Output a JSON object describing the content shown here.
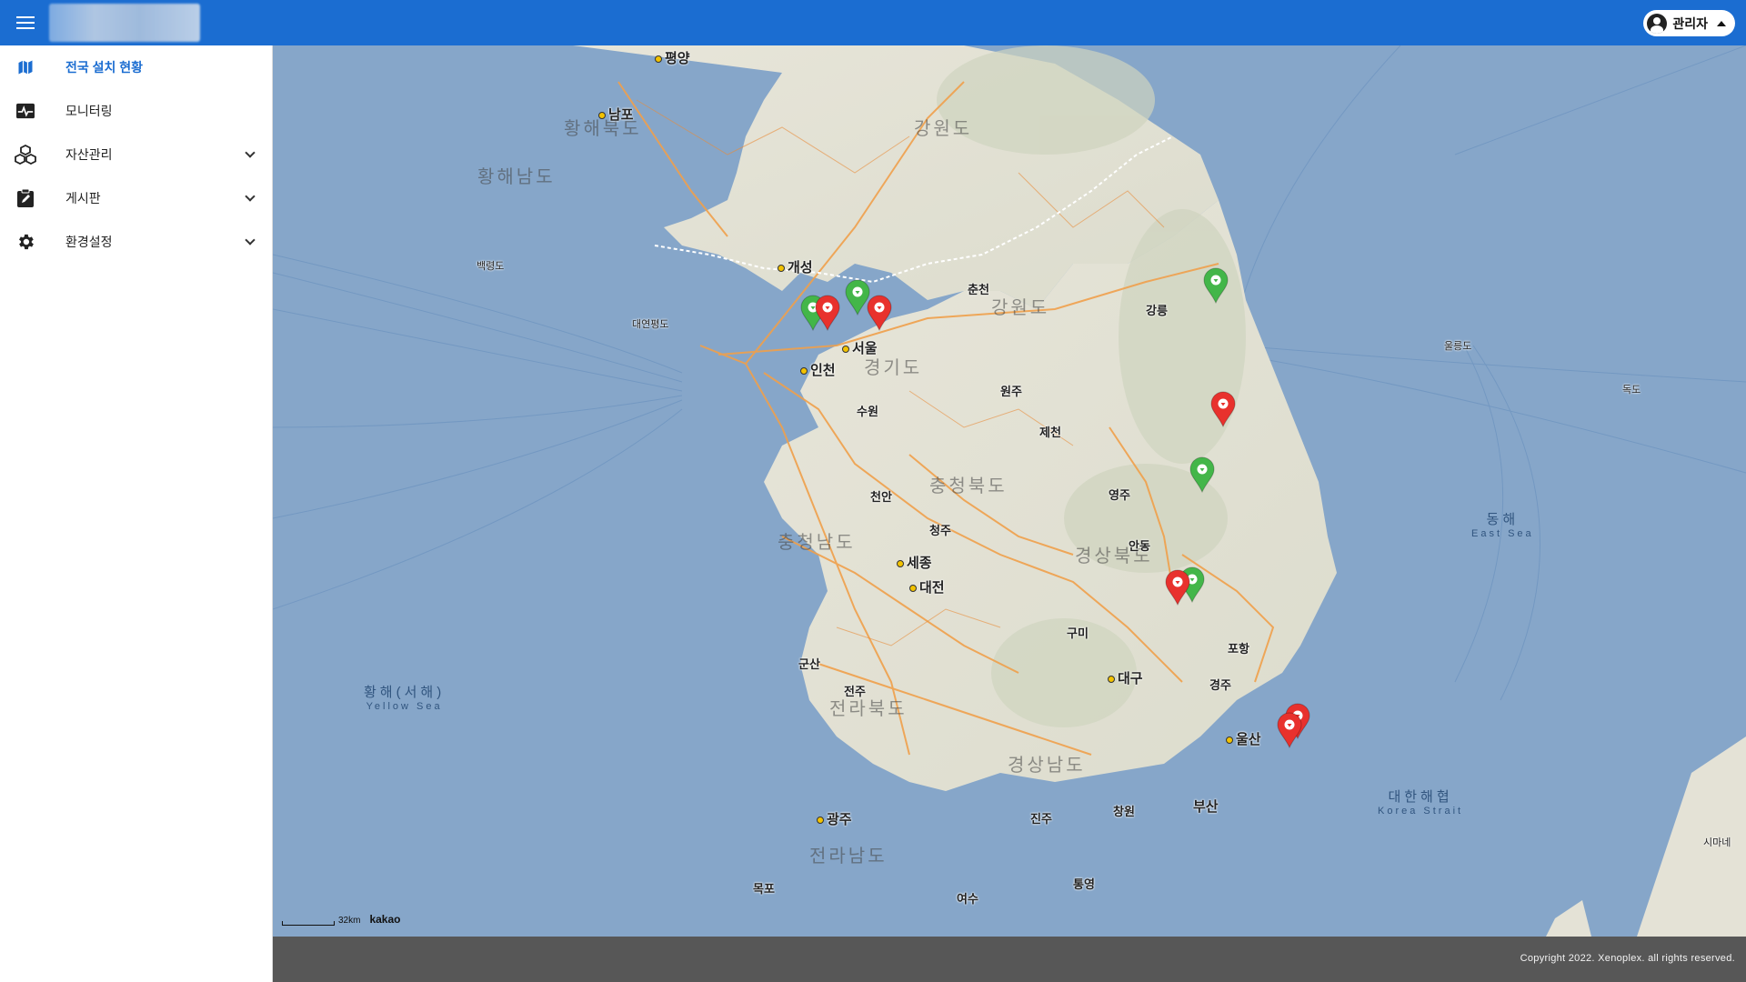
{
  "header": {
    "user_name": "관리자"
  },
  "sidebar": {
    "items": [
      {
        "label": "전국 설치 현황",
        "icon": "map-icon",
        "active": true,
        "expandable": false
      },
      {
        "label": "모니터링",
        "icon": "pulse-icon",
        "active": false,
        "expandable": false
      },
      {
        "label": "자산관리",
        "icon": "cubes-icon",
        "active": false,
        "expandable": true
      },
      {
        "label": "게시판",
        "icon": "clipboard-edit-icon",
        "active": false,
        "expandable": true
      },
      {
        "label": "환경설정",
        "icon": "gear-icon",
        "active": false,
        "expandable": true
      }
    ]
  },
  "map": {
    "provinces": [
      "강원도",
      "경기도",
      "충청북도",
      "충청남도",
      "경상북도",
      "경상남도",
      "전라북도",
      "전라남도",
      "황해북도",
      "황해남도",
      "강원도 "
    ],
    "cities": [
      "평양",
      "남포",
      "개성",
      "서울",
      "인천",
      "춘천",
      "강릉",
      "원주",
      "수원",
      "청주",
      "세종",
      "대전",
      "안동",
      "대구",
      "울산",
      "부산",
      "포항",
      "광주",
      "목포",
      "여수",
      "전주",
      "군산",
      "진주",
      "창원",
      "영주",
      "구미",
      "경주",
      "천안",
      "제천",
      "통영"
    ],
    "seas": [
      {
        "ko": "황해(서해)",
        "en": "Yellow Sea"
      },
      {
        "ko": "동해",
        "en": "East Sea"
      },
      {
        "ko": "대한해협",
        "en": "Korea Strait"
      }
    ],
    "other_labels": [
      "시마네",
      "울릉도",
      "독도",
      "백령도",
      "대연평도"
    ],
    "markers": [
      {
        "status": "normal",
        "color": "#43b649"
      },
      {
        "status": "normal",
        "color": "#43b649"
      },
      {
        "status": "alert",
        "color": "#e8312d"
      },
      {
        "status": "alert",
        "color": "#e8312d"
      },
      {
        "status": "normal",
        "color": "#43b649"
      },
      {
        "status": "alert",
        "color": "#e8312d"
      },
      {
        "status": "normal",
        "color": "#43b649"
      },
      {
        "status": "normal",
        "color": "#43b649"
      },
      {
        "status": "alert",
        "color": "#e8312d"
      },
      {
        "status": "alert",
        "color": "#e8312d"
      },
      {
        "status": "alert",
        "color": "#e8312d"
      }
    ],
    "scale_label": "32km",
    "provider": "kakao"
  },
  "footer": {
    "copyright": "Copyright 2022. Xenoplex. all rights reserved."
  }
}
